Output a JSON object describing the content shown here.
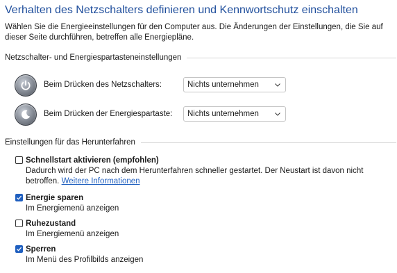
{
  "header": {
    "title": "Verhalten des Netzschalters definieren und Kennwortschutz einschalten",
    "description": "Wählen Sie die Energieeinstellungen für den Computer aus. Die Änderungen der Einstellungen, die Sie auf dieser Seite durchführen, betreffen alle Energiepläne."
  },
  "power_section": {
    "heading": "Netzschalter- und Energiespartasteneinstellungen",
    "rows": [
      {
        "label": "Beim Drücken des Netzschalters:",
        "value": "Nichts unternehmen",
        "icon": "power-button-icon"
      },
      {
        "label": "Beim Drücken der Energiespartaste:",
        "value": "Nichts unternehmen",
        "icon": "sleep-button-icon"
      }
    ]
  },
  "shutdown_section": {
    "heading": "Einstellungen für das Herunterfahren",
    "items": [
      {
        "label": "Schnellstart aktivieren (empfohlen)",
        "checked": false,
        "description": "Dadurch wird der PC nach dem Herunterfahren schneller gestartet. Der Neustart ist davon nicht betroffen.",
        "link": "Weitere Informationen"
      },
      {
        "label": "Energie sparen",
        "checked": true,
        "description": "Im Energiemenü anzeigen"
      },
      {
        "label": "Ruhezustand",
        "checked": false,
        "description": "Im Energiemenü anzeigen"
      },
      {
        "label": "Sperren",
        "checked": true,
        "description": "Im Menü des Profilbilds anzeigen"
      }
    ]
  },
  "colors": {
    "title": "#1f4e9c",
    "accent": "#1f5fbf",
    "link": "#1f5fbf"
  }
}
